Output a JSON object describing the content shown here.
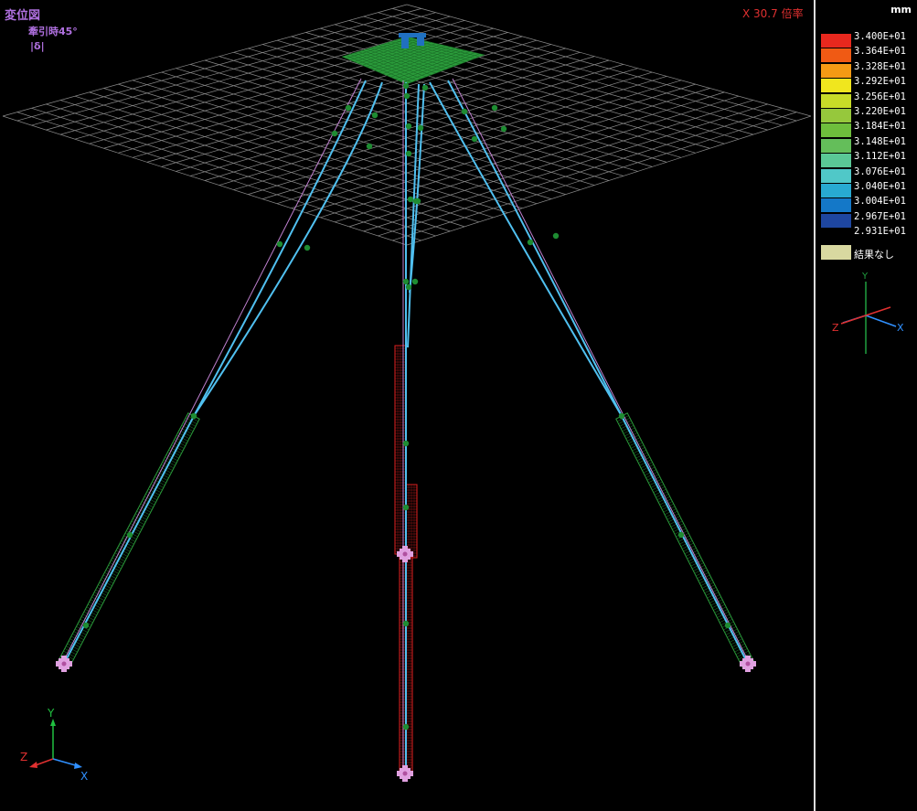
{
  "view": {
    "title": "変位図",
    "subtitle": "牽引時45°",
    "quantity": "|δ|",
    "scale_factor": "X 30.7 倍率"
  },
  "legend": {
    "unit": "mm",
    "entries": [
      {
        "value": "3.400E+01",
        "color": "#e8281e"
      },
      {
        "value": "3.364E+01",
        "color": "#f05a14"
      },
      {
        "value": "3.328E+01",
        "color": "#f59a14"
      },
      {
        "value": "3.292E+01",
        "color": "#f0e61e"
      },
      {
        "value": "3.256E+01",
        "color": "#c8dc28"
      },
      {
        "value": "3.220E+01",
        "color": "#96c83c"
      },
      {
        "value": "3.184E+01",
        "color": "#6ebe3c"
      },
      {
        "value": "3.148E+01",
        "color": "#64be5a"
      },
      {
        "value": "3.112E+01",
        "color": "#5ac896"
      },
      {
        "value": "3.076E+01",
        "color": "#50c8c8"
      },
      {
        "value": "3.040E+01",
        "color": "#28aad2"
      },
      {
        "value": "3.004E+01",
        "color": "#1478c8"
      },
      {
        "value": "2.967E+01",
        "color": "#1e46a0"
      },
      {
        "value": "2.931E+01",
        "color": null
      }
    ],
    "no_result_label": "結果なし",
    "no_result_color": "#d8d8a0"
  },
  "axes": {
    "y": "Y",
    "z": "Z",
    "x": "X"
  },
  "colors": {
    "grid": "#8a8a8a",
    "cable": "#50c0f0",
    "original_shape": "#c080d0",
    "node": "#1e8c32",
    "mesh_green": "#2a9a3a",
    "mesh_red": "#e02020",
    "anchor": "#e0a0e0",
    "blue_part": "#2070c0"
  }
}
